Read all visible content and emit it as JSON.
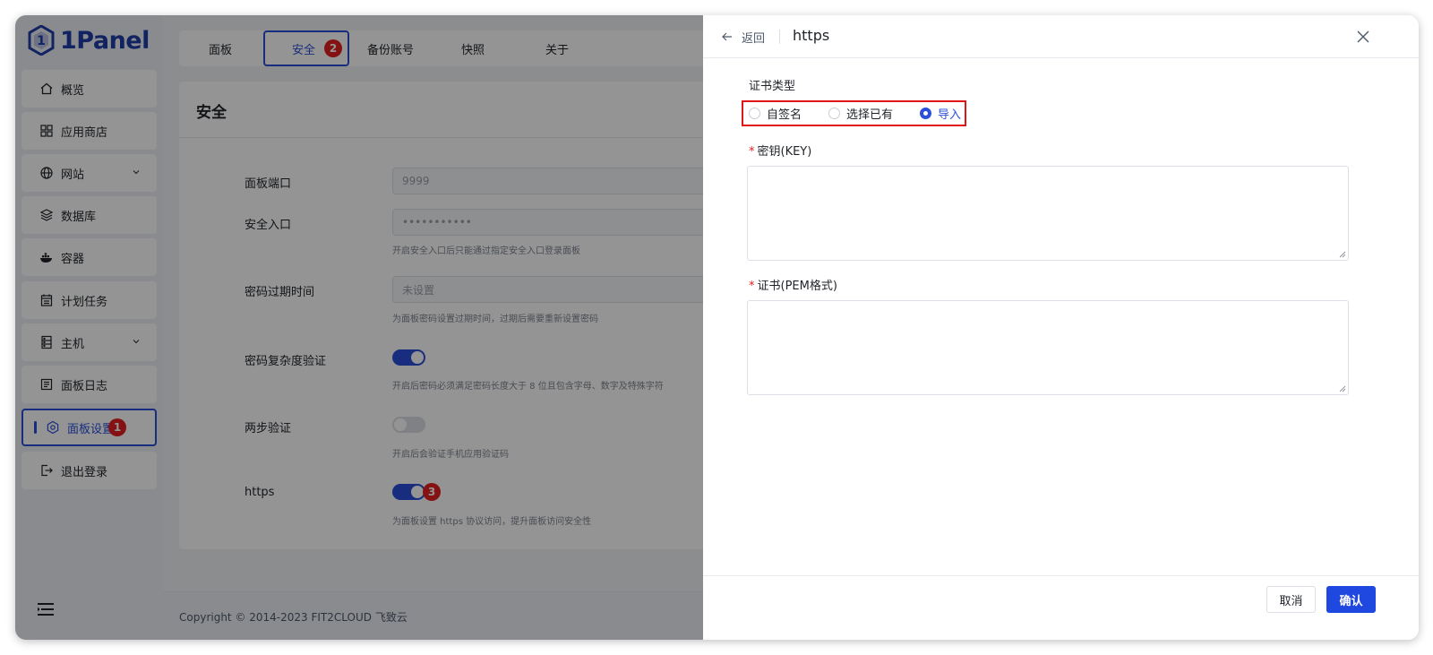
{
  "app": {
    "name": "1Panel"
  },
  "sidebar": {
    "items": [
      {
        "label": "概览",
        "icon": "home-icon"
      },
      {
        "label": "应用商店",
        "icon": "grid-icon"
      },
      {
        "label": "网站",
        "icon": "globe-icon",
        "expandable": true
      },
      {
        "label": "数据库",
        "icon": "layers-icon"
      },
      {
        "label": "容器",
        "icon": "docker-icon"
      },
      {
        "label": "计划任务",
        "icon": "calendar-icon"
      },
      {
        "label": "主机",
        "icon": "server-icon",
        "expandable": true
      },
      {
        "label": "面板日志",
        "icon": "log-icon"
      },
      {
        "label": "面板设置",
        "icon": "gear-icon",
        "active": true
      },
      {
        "label": "退出登录",
        "icon": "logout-icon"
      }
    ],
    "active_badge": "1"
  },
  "tabs": [
    {
      "label": "面板"
    },
    {
      "label": "安全",
      "active": true
    },
    {
      "label": "备份账号"
    },
    {
      "label": "快照"
    },
    {
      "label": "关于"
    }
  ],
  "tab_badge": "2",
  "security": {
    "title": "安全",
    "port_label": "面板端口",
    "port_value": "9999",
    "entrance_label": "安全入口",
    "entrance_value": "•••••••••••",
    "entrance_hint": "开启安全入口后只能通过指定安全入口登录面板",
    "expire_label": "密码过期时间",
    "expire_value": "未设置",
    "expire_hint": "为面板密码设置过期时间，过期后需要重新设置密码",
    "complexity_label": "密码复杂度验证",
    "complexity_on": true,
    "complexity_hint": "开启后密码必须满足密码长度大于 8 位且包含字母、数字及特殊字符",
    "mfa_label": "两步验证",
    "mfa_on": false,
    "mfa_hint": "开启后会验证手机应用验证码",
    "https_label": "https",
    "https_on": true,
    "https_hint": "为面板设置 https 协议访问，提升面板访问安全性",
    "https_badge": "3"
  },
  "footer": {
    "copyright": "Copyright © 2014-2023 FIT2CLOUD 飞致云"
  },
  "drawer": {
    "back_label": "返回",
    "title": "https",
    "cert_type_label": "证书类型",
    "cert_types": [
      {
        "label": "自签名",
        "checked": false
      },
      {
        "label": "选择已有",
        "checked": false
      },
      {
        "label": "导入",
        "checked": true
      }
    ],
    "key_label": "密钥(KEY)",
    "key_value": "",
    "cert_label": "证书(PEM格式)",
    "cert_value": "",
    "cancel_label": "取消",
    "confirm_label": "确认"
  },
  "colors": {
    "primary": "#2a4fd8",
    "badge": "#e62020",
    "highlight": "#e01515"
  }
}
